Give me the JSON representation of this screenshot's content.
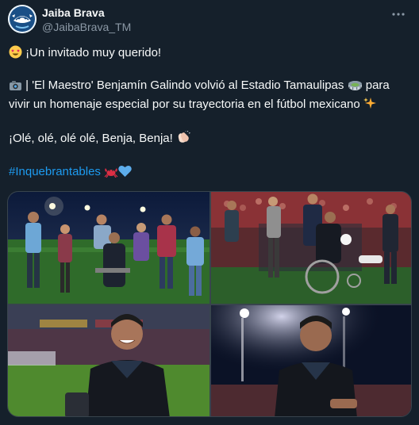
{
  "author": {
    "display_name": "Jaiba Brava",
    "handle": "@JaibaBrava_TM",
    "avatar_icon": "crab-logo-icon"
  },
  "more_icon": "more-options-icon",
  "tweet": {
    "line1": "¡Un invitado muy querido!",
    "line2": " | 'El Maestro' Benjamín Galindo volvió al Estadio Tamaulipas ",
    "line2_end": " para vivir un homenaje especial por su trayectoria en el fútbol mexicano ",
    "line3": "¡Olé, olé, olé olé, Benja, Benja! ",
    "hashtag": "#Inquebrantables",
    "emojis": {
      "line1": "star-struck-face-icon",
      "line2_start": "camera-icon",
      "line2_mid": "stadium-icon",
      "line2_end": "sparkles-icon",
      "line3": "clapping-hands-icon",
      "hashtag_1": "crab-icon",
      "hashtag_2": "blue-heart-icon"
    }
  },
  "media": {
    "photos": [
      {
        "name": "photo-group-on-field"
      },
      {
        "name": "photo-wheelchair-crowd"
      },
      {
        "name": "photo-closeup-smile"
      },
      {
        "name": "photo-portrait-stadium-lights"
      }
    ]
  },
  "colors": {
    "background": "#15202b",
    "text": "#f7f9f9",
    "secondary_text": "#8b98a5",
    "link": "#1d9bf0",
    "border": "#38444d"
  }
}
